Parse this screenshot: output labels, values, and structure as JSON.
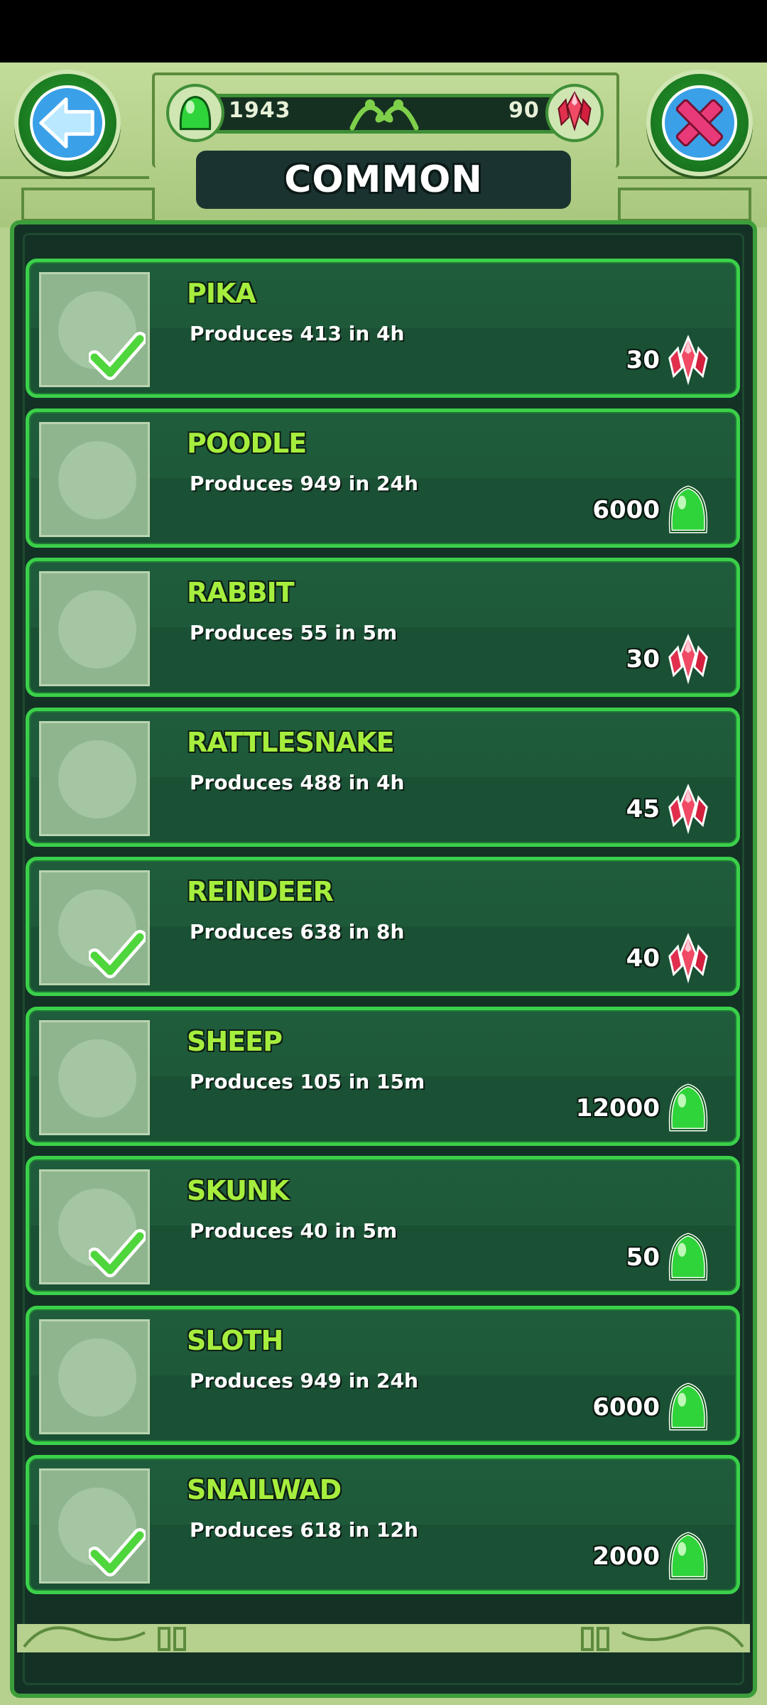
{
  "header": {
    "title": "COMMON",
    "gel_count": "1943",
    "gem_count": "90"
  },
  "colors": {
    "accent": "#3bd04a",
    "name_text": "#a6ee3d",
    "gel": "#2fd43a",
    "gem": "#e0304e"
  },
  "icons": {
    "back": "left-arrow-icon",
    "close": "close-x-icon",
    "gel": "gel-drop-icon",
    "gem": "red-crystal-icon",
    "owned": "checkmark-icon"
  },
  "items": [
    {
      "name": "PIKA",
      "produces": "Produces 413 in 4h",
      "price": "30",
      "currency": "gem",
      "owned": true
    },
    {
      "name": "POODLE",
      "produces": "Produces 949 in 24h",
      "price": "6000",
      "currency": "gel",
      "owned": false
    },
    {
      "name": "RABBIT",
      "produces": "Produces 55 in 5m",
      "price": "30",
      "currency": "gem",
      "owned": false
    },
    {
      "name": "RATTLESNAKE",
      "produces": "Produces 488 in 4h",
      "price": "45",
      "currency": "gem",
      "owned": false
    },
    {
      "name": "REINDEER",
      "produces": "Produces 638 in 8h",
      "price": "40",
      "currency": "gem",
      "owned": true
    },
    {
      "name": "SHEEP",
      "produces": "Produces 105 in 15m",
      "price": "12000",
      "currency": "gel",
      "owned": false
    },
    {
      "name": "SKUNK",
      "produces": "Produces 40 in 5m",
      "price": "50",
      "currency": "gel",
      "owned": true
    },
    {
      "name": "SLOTH",
      "produces": "Produces 949 in 24h",
      "price": "6000",
      "currency": "gel",
      "owned": false
    },
    {
      "name": "SNAILWAD",
      "produces": "Produces 618 in 12h",
      "price": "2000",
      "currency": "gel",
      "owned": true
    }
  ]
}
